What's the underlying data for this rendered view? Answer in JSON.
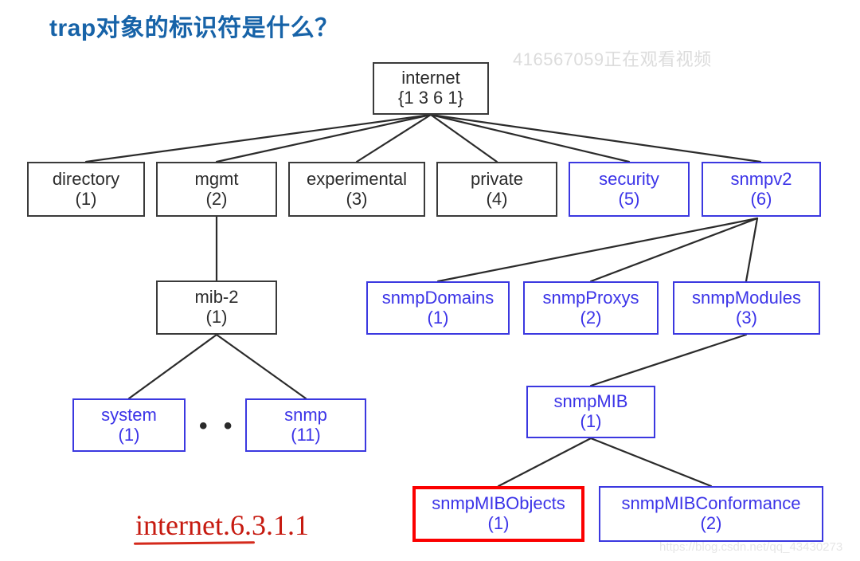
{
  "page": {
    "title": "trap对象的标识符是什么？",
    "watermark_top": "416567059正在观看视频",
    "watermark_bottom": "https://blog.csdn.net/qq_43430273",
    "annotation": "internet.6.3.1.1",
    "ellipsis": "• • •",
    "colors": {
      "title_blue": "#1763a8",
      "node_blue": "#3b33e8",
      "node_black": "#2b2b2b",
      "highlight_red": "#fb0000",
      "annotation_red": "#c61a10"
    }
  },
  "tree": {
    "root": {
      "label": "internet",
      "number": "{1 3 6 1}",
      "style": "black"
    },
    "nodes": [
      {
        "id": "directory",
        "label": "directory",
        "number": "(1)",
        "style": "black"
      },
      {
        "id": "mgmt",
        "label": "mgmt",
        "number": "(2)",
        "style": "black"
      },
      {
        "id": "experimental",
        "label": "experimental",
        "number": "(3)",
        "style": "black"
      },
      {
        "id": "private",
        "label": "private",
        "number": "(4)",
        "style": "black"
      },
      {
        "id": "security",
        "label": "security",
        "number": "(5)",
        "style": "blue"
      },
      {
        "id": "snmpv2",
        "label": "snmpv2",
        "number": "(6)",
        "style": "blue"
      },
      {
        "id": "mib2",
        "label": "mib-2",
        "number": "(1)",
        "style": "black"
      },
      {
        "id": "snmpDomains",
        "label": "snmpDomains",
        "number": "(1)",
        "style": "blue"
      },
      {
        "id": "snmpProxys",
        "label": "snmpProxys",
        "number": "(2)",
        "style": "blue"
      },
      {
        "id": "snmpModules",
        "label": "snmpModules",
        "number": "(3)",
        "style": "blue"
      },
      {
        "id": "system",
        "label": "system",
        "number": "(1)",
        "style": "blue"
      },
      {
        "id": "snmp",
        "label": "snmp",
        "number": "(11)",
        "style": "blue"
      },
      {
        "id": "snmpMIB",
        "label": "snmpMIB",
        "number": "(1)",
        "style": "blue"
      },
      {
        "id": "snmpMIBObjects",
        "label": "snmpMIBObjects",
        "number": "(1)",
        "style": "red"
      },
      {
        "id": "snmpMIBConformance",
        "label": "snmpMIBConformance",
        "number": "(2)",
        "style": "blue"
      }
    ]
  }
}
